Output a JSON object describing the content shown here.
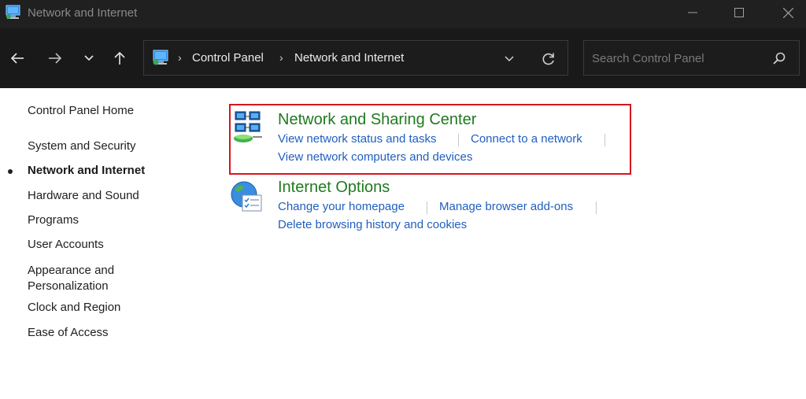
{
  "window": {
    "title": "Network and Internet",
    "controls": {
      "minimize": "minimize-icon",
      "maximize": "maximize-icon",
      "close": "close-icon"
    }
  },
  "nav": {
    "icons": [
      "back-arrow-icon",
      "forward-arrow-icon",
      "chevron-down-icon",
      "up-arrow-icon"
    ]
  },
  "address": {
    "breadcrumbs": [
      "Control Panel",
      "Network and Internet"
    ],
    "separator": "›"
  },
  "search": {
    "placeholder": "Search Control Panel"
  },
  "sidebar": {
    "items": [
      {
        "label": "Control Panel Home"
      },
      {
        "label": "System and Security"
      },
      {
        "label": "Network and Internet",
        "active": true
      },
      {
        "label": "Hardware and Sound"
      },
      {
        "label": "Programs"
      },
      {
        "label": "User Accounts"
      },
      {
        "label": "Appearance and\nPersonalization"
      },
      {
        "label": "Clock and Region"
      },
      {
        "label": "Ease of Access"
      }
    ]
  },
  "categories": [
    {
      "title": "Network and Sharing Center",
      "icon": "network-sharing-icon",
      "links": [
        "View network status and tasks",
        "Connect to a network",
        "View network computers and devices"
      ]
    },
    {
      "title": "Internet Options",
      "icon": "internet-options-icon",
      "links": [
        "Change your homepage",
        "Manage browser add-ons",
        "Delete browsing history and cookies"
      ]
    }
  ],
  "colors": {
    "titlebar": "#202020",
    "navbar": "#191919",
    "category_title": "#1f7a1f",
    "link": "#1f5fbf",
    "highlight": "#d8141b"
  }
}
